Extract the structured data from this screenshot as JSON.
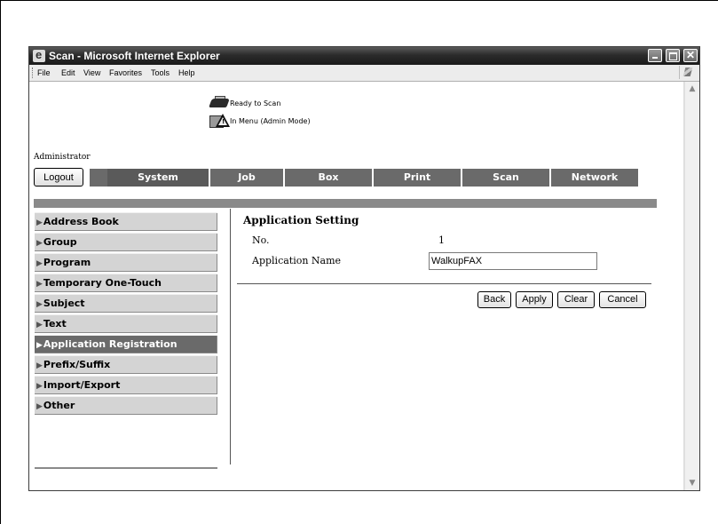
{
  "window": {
    "title": "Scan - Microsoft Internet Explorer",
    "menu": [
      "File",
      "Edit",
      "View",
      "Favorites",
      "Tools",
      "Help"
    ]
  },
  "status": {
    "ready": "Ready to Scan",
    "mode": "In Menu (Admin Mode)"
  },
  "user": "Administrator",
  "logout_label": "Logout",
  "tabs": [
    "System",
    "Job",
    "Box",
    "Print",
    "Scan",
    "Network"
  ],
  "active_tab": "System",
  "sidebar": {
    "items": [
      "Address Book",
      "Group",
      "Program",
      "Temporary One-Touch",
      "Subject",
      "Text",
      "Application Registration",
      "Prefix/Suffix",
      "Import/Export",
      "Other"
    ],
    "active": "Application Registration"
  },
  "form": {
    "title": "Application Setting",
    "no_label": "No.",
    "no_value": "1",
    "app_name_label": "Application Name",
    "app_name_value": "WalkupFAX"
  },
  "buttons": {
    "back": "Back",
    "apply": "Apply",
    "clear": "Clear",
    "cancel": "Cancel"
  }
}
